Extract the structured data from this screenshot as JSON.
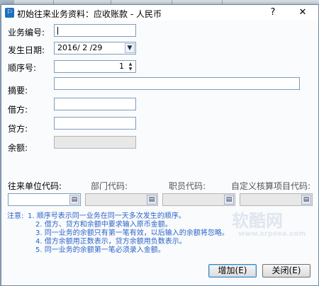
{
  "window": {
    "title": "初始往来业务资料：应收账款 - 人民币",
    "help_label": "?",
    "close_label": "✕"
  },
  "fields": {
    "biz_no": {
      "label": "业务编号:",
      "value": ""
    },
    "date": {
      "label": "发生日期:",
      "value": "2016/ 2 /29"
    },
    "seq": {
      "label": "顺序号:",
      "value": "1"
    },
    "summary": {
      "label": "摘要:",
      "value": ""
    },
    "debit": {
      "label": "借方:",
      "value": ""
    },
    "credit": {
      "label": "贷方:",
      "value": ""
    },
    "balance": {
      "label": "余额:",
      "value": ""
    }
  },
  "codes": {
    "unit": {
      "label": "往来单位代码:",
      "value": ""
    },
    "dept": {
      "label": "部门代码:",
      "value": ""
    },
    "staff": {
      "label": "职员代码:",
      "value": ""
    },
    "custom": {
      "label": "自定义核算项目代码:",
      "value": ""
    }
  },
  "notes": {
    "prefix": "注意:",
    "lines": [
      "1. 顺序号表示同一业务在同一天多次发生的顺序。",
      "2. 借方、贷方和余额中要求输入原币金额。",
      "3. 同一业务的余额只有第一笔有效，以后输入的余额将忽略。",
      "4. 借方余额用正数表示，贷方余额用负数表示。",
      "5. 同一业务的余额第一笔必须录入金额。"
    ]
  },
  "buttons": {
    "add": "增加(E)",
    "close": "关闭(E)"
  },
  "watermark": {
    "text": "软酷网",
    "url": "www.srpsea.com"
  },
  "colors": {
    "note": "#2a63c8",
    "accent": "#1d6fbf"
  }
}
